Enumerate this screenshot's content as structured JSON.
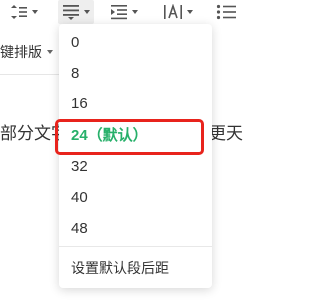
{
  "toolbar": {
    "buttons": [
      {
        "name": "line-spacing-icon"
      },
      {
        "name": "paragraph-spacing-icon",
        "active": true
      },
      {
        "name": "indent-icon"
      },
      {
        "name": "character-spacing-icon"
      },
      {
        "name": "list-icon"
      }
    ]
  },
  "row2": {
    "label": "键排版"
  },
  "document": {
    "text_left": "部分文字",
    "text_right": "更天"
  },
  "dropdown": {
    "items": [
      "0",
      "8",
      "16",
      "24（默认）",
      "32",
      "40",
      "48"
    ],
    "selected": "24（默认）",
    "footer_label": "设置默认段后距"
  },
  "colors": {
    "selected_text": "#27b06a",
    "highlight_border": "#e8231c"
  }
}
